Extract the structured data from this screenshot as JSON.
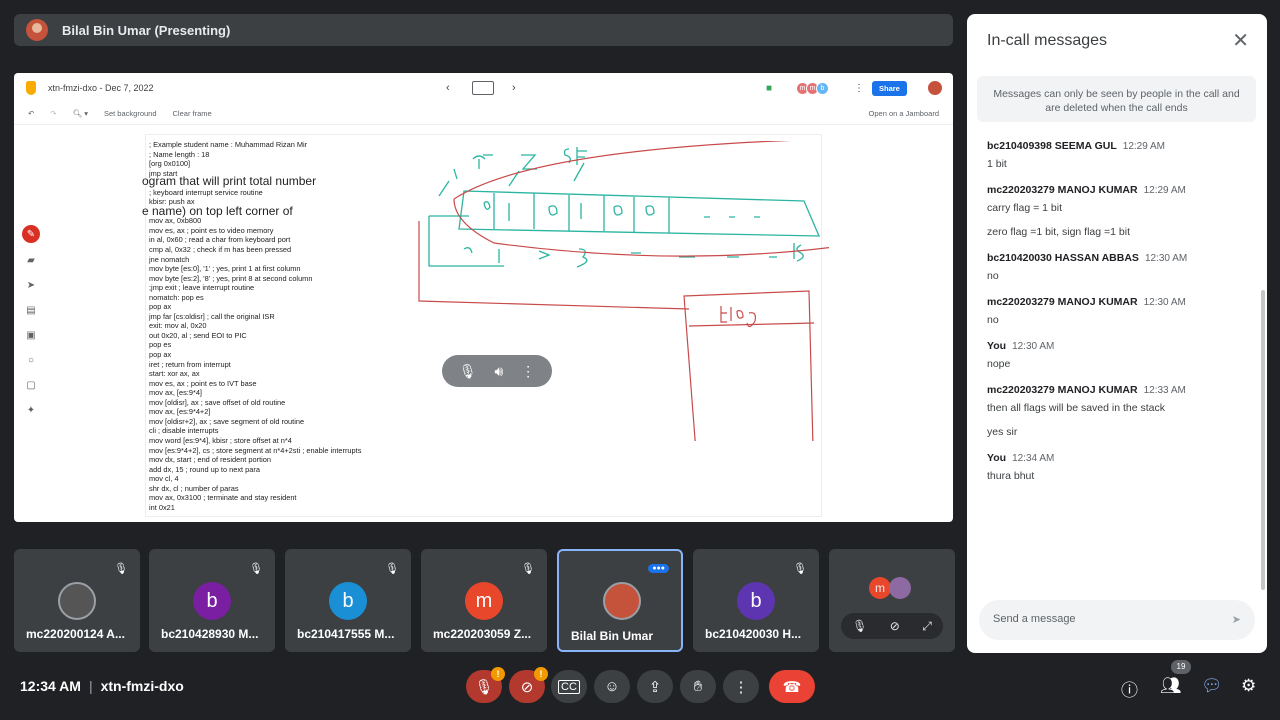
{
  "presenter_bar": {
    "label": "Bilal Bin Umar (Presenting)"
  },
  "jamboard": {
    "title": "xtn-fmzi-dxo - Dec 7, 2022",
    "share_label": "Share",
    "set_background": "Set background",
    "clear_frame": "Clear frame",
    "open_in": "Open on a Jamboard",
    "avatars": [
      "m",
      "m",
      "b"
    ],
    "code_lines": [
      "; Example student name : Muhammad Rizan Mir",
      "; Name length : 18",
      "[org 0x0100]",
      "jmp start",
      "",
      "; keyboard interrupt service routine",
      "kbisr: push ax",
      "",
      "mov ax, 0xb800",
      "mov es, ax ; point es to video memory",
      "in al, 0x60 ; read a char from keyboard port",
      "cmp al, 0x32 ; check if m has been pressed",
      "jne nomatch",
      "mov byte [es:0], '1' ; yes, print 1 at first column",
      "mov byte [es:2], '8' ; yes, print 8 at second column",
      ";jmp exit ; leave interrupt routine",
      "nomatch: pop es",
      "pop ax",
      "jmp far [cs:oldisr] ; call the original ISR",
      "exit: mov al, 0x20",
      "out 0x20, al ; send EOI to PIC",
      "pop es",
      "pop ax",
      "iret ; return from interrupt",
      "start: xor ax, ax",
      "mov es, ax ; point es to IVT base",
      "mov ax, [es:9*4]",
      "mov [oldisr], ax ; save offset of old routine",
      "mov ax, [es:9*4+2]",
      "mov [oldisr+2], ax ; save segment of old routine",
      "cli ; disable interrupts",
      "mov word [es:9*4], kbisr ; store offset at n*4",
      "mov [es:9*4+2], cs ; store segment at n*4+2sti ; enable interrupts",
      "mov dx, start ; end of resident portion",
      "add dx, 15 ; round up to next para",
      "mov cl, 4",
      "shr dx, cl ; number of paras",
      "mov ax, 0x3100 ; terminate and stay resident",
      "int 0x21"
    ],
    "overlay_line1": "ogram that will print total number",
    "overlay_line2": "e name) on top left corner of"
  },
  "panel": {
    "title": "In-call messages",
    "notice": "Messages can only be seen by people in the call and are deleted when the call ends",
    "messages": [
      {
        "sender": "bc210409398 SEEMA GUL",
        "time": "12:29 AM",
        "lines": [
          "1 bit"
        ]
      },
      {
        "sender": "mc220203279 MANOJ KUMAR",
        "time": "12:29 AM",
        "lines": [
          "carry flag = 1 bit",
          "zero flag =1 bit, sign flag =1 bit"
        ]
      },
      {
        "sender": "bc210420030 HASSAN ABBAS",
        "time": "12:30 AM",
        "lines": [
          "no"
        ]
      },
      {
        "sender": "mc220203279 MANOJ KUMAR",
        "time": "12:30 AM",
        "lines": [
          "no"
        ]
      },
      {
        "sender": "You",
        "time": "12:30 AM",
        "lines": [
          "nope"
        ]
      },
      {
        "sender": "mc220203279 MANOJ KUMAR",
        "time": "12:33 AM",
        "lines": [
          "then all flags will be saved in the stack",
          "yes sir"
        ]
      },
      {
        "sender": "You",
        "time": "12:34 AM",
        "lines": [
          "thura bhut"
        ]
      }
    ],
    "compose_placeholder": "Send a message"
  },
  "tiles": [
    {
      "name": "mc220200124 A...",
      "initial": "",
      "color": "#3c4043"
    },
    {
      "name": "bc210428930 M...",
      "initial": "b",
      "color": "#7b1fa2"
    },
    {
      "name": "bc210417555 M...",
      "initial": "b",
      "color": "#1a8fd6"
    },
    {
      "name": "mc220203059 Z...",
      "initial": "m",
      "color": "#e8472c"
    },
    {
      "name": "Bilal Bin Umar",
      "initial": "",
      "color": "#c5523b"
    },
    {
      "name": "bc210420030 H...",
      "initial": "b",
      "color": "#5e35b1"
    }
  ],
  "extra_tile_initial": "m",
  "bottom": {
    "time": "12:34 AM",
    "meeting_code": "xtn-fmzi-dxo",
    "people_count": "19"
  }
}
